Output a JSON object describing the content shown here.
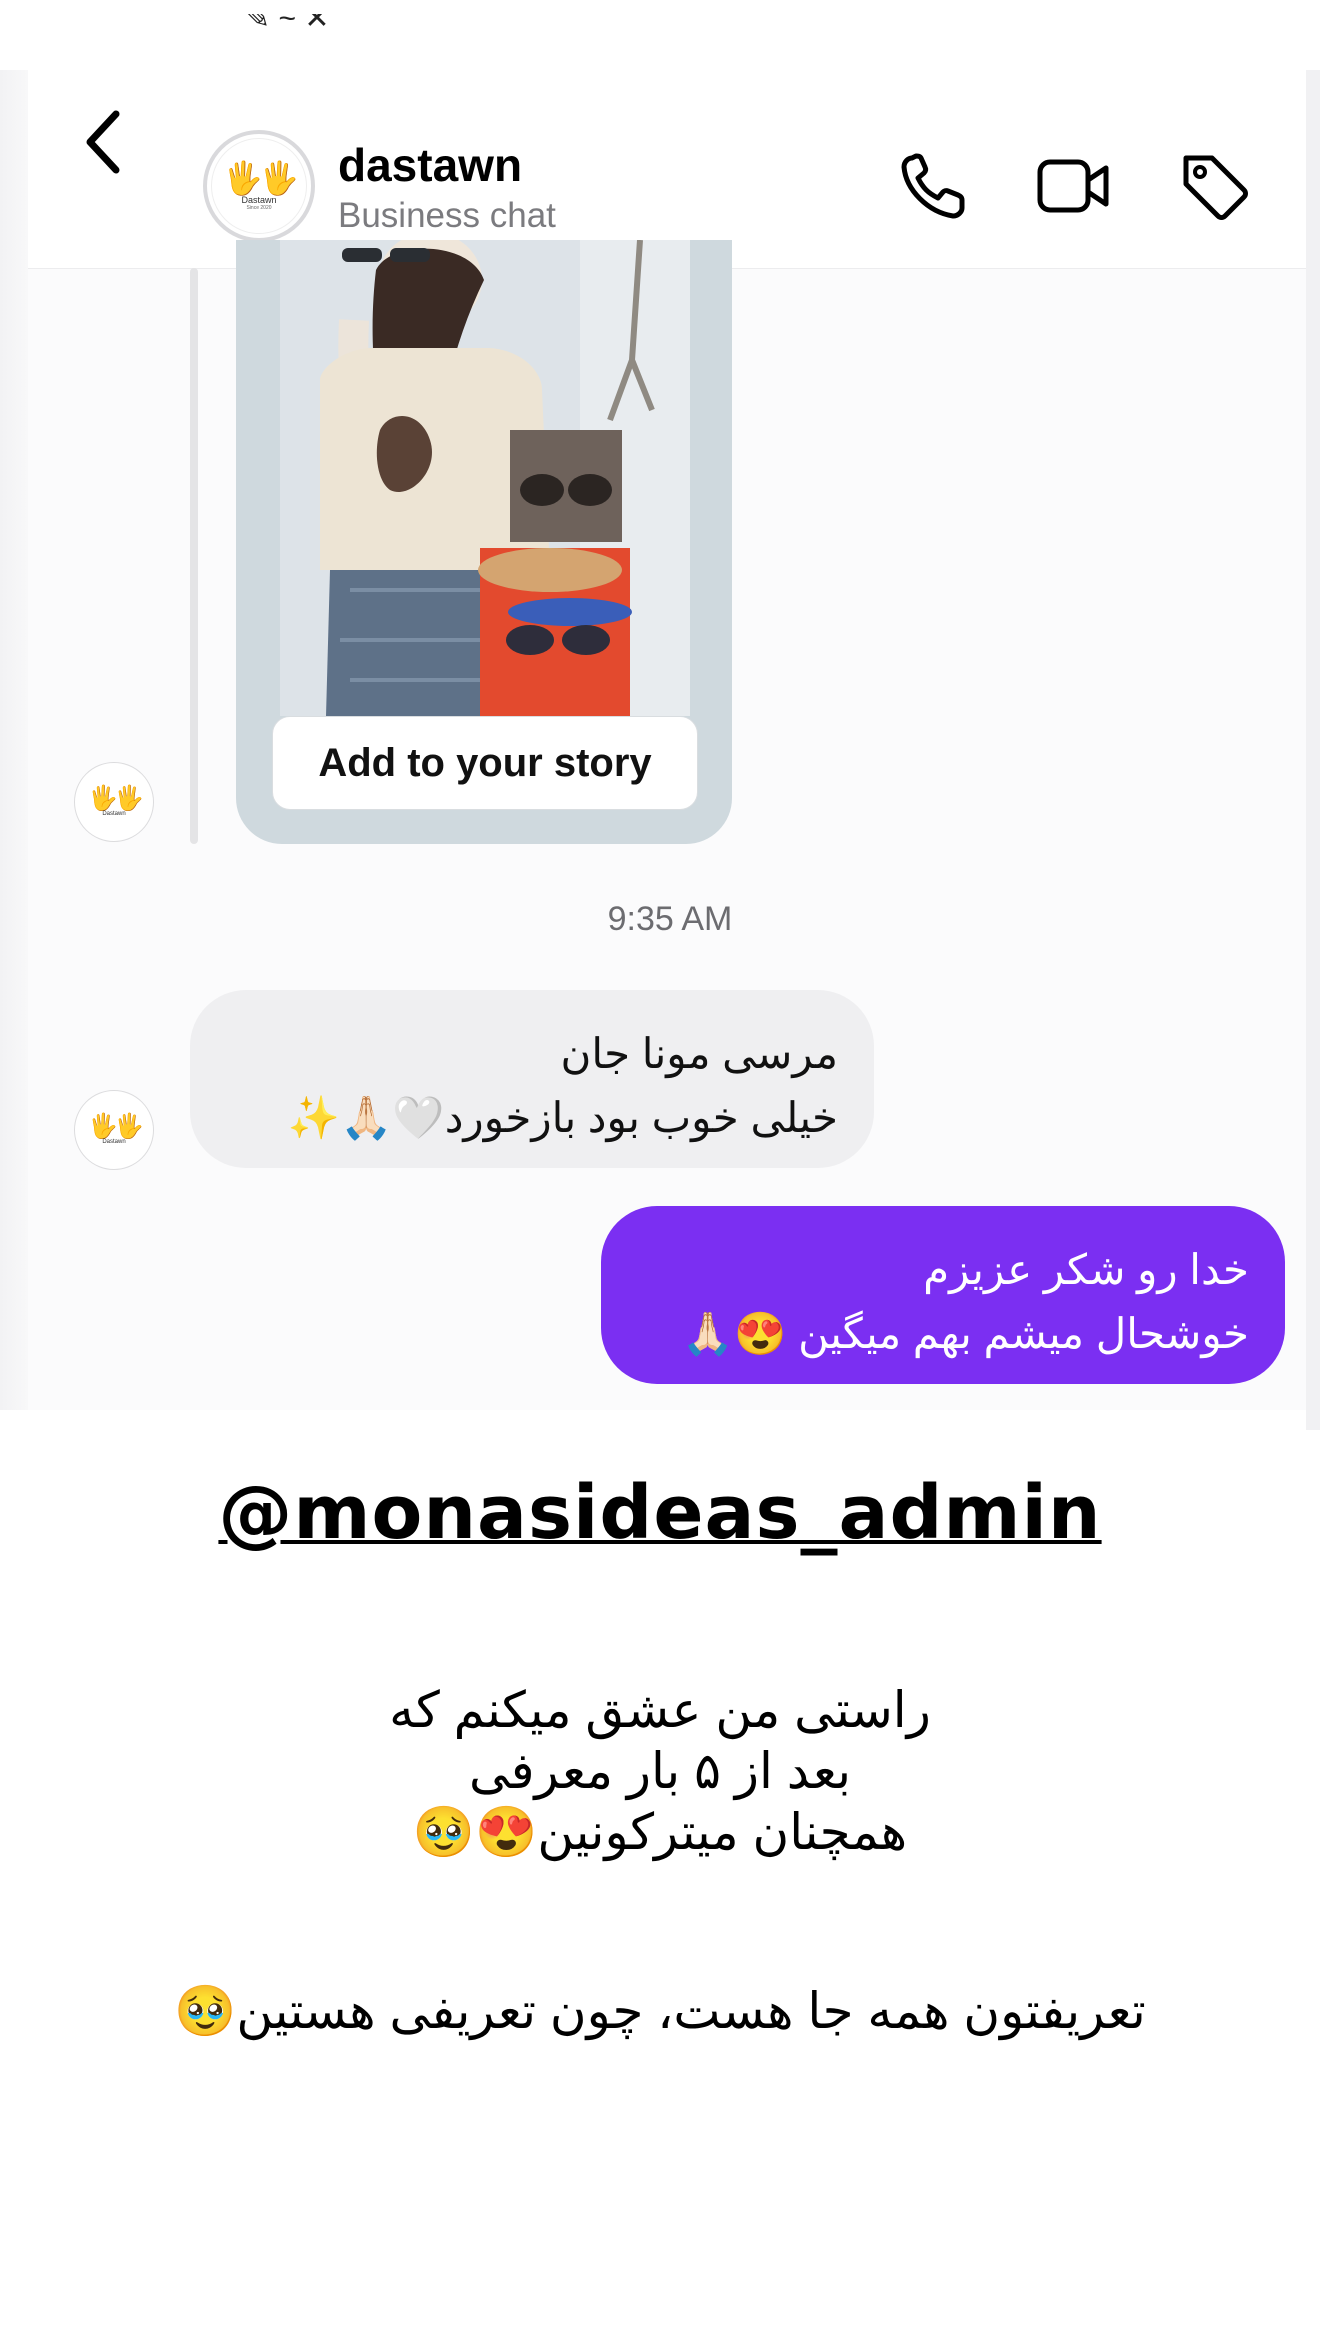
{
  "header": {
    "contact_name": "dastawn",
    "contact_subtitle": "Business chat",
    "avatar_brand": "Dastawn",
    "avatar_since": "Since 2020",
    "avatar_hands": "🖐🖐"
  },
  "story": {
    "button_label": "Add to your story"
  },
  "messages": {
    "timestamp": "9:35 AM",
    "incoming": {
      "line1": "مرسی مونا جان",
      "line2": "خیلی خوب بود بازخورد🤍🙏🏻✨"
    },
    "outgoing": {
      "line1": "خدا رو شکر عزیزم",
      "line2": "خوشحال میشم بهم میگین 😍🙏🏻"
    }
  },
  "overlay": {
    "handle": "@monasideas_admin",
    "caption_line1": "راستی من عشق میکنم که",
    "caption_line2": "بعد از ۵ بار معرفی",
    "caption_line3": "همچنان میترکونین😍🥹",
    "caption2": "تعریفتون همه جا هست، چون تعریفی هستین🥹"
  },
  "colors": {
    "outgoing_bubble": "#7b2ff2",
    "incoming_bubble": "#efeff1",
    "story_card_bg": "#cfd9de"
  }
}
